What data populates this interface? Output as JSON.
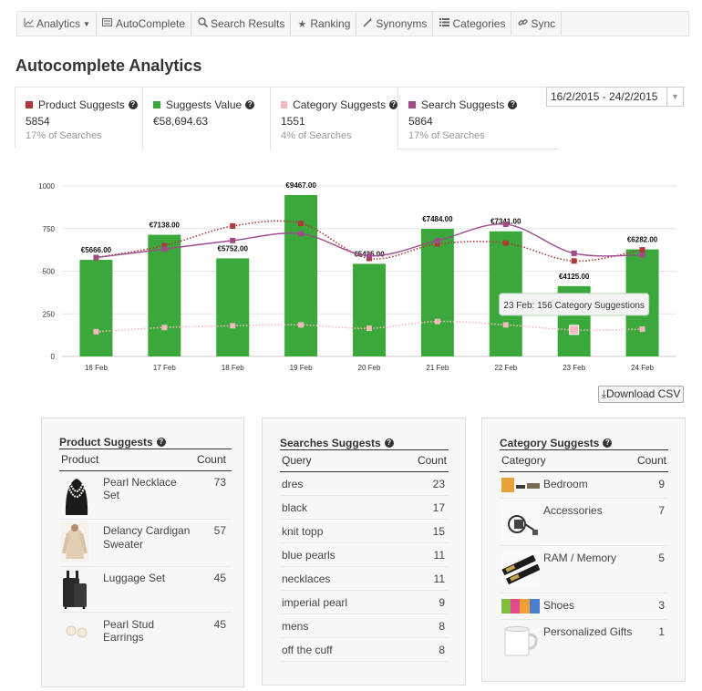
{
  "nav": {
    "items": [
      {
        "label": "Analytics",
        "icon": "line-chart-icon"
      },
      {
        "label": "AutoComplete",
        "icon": "autocomplete-icon"
      },
      {
        "label": "Search Results",
        "icon": "search-icon"
      },
      {
        "label": "Ranking",
        "icon": "star-icon"
      },
      {
        "label": "Synonyms",
        "icon": "magic-wand-icon"
      },
      {
        "label": "Categories",
        "icon": "list-icon"
      },
      {
        "label": "Sync",
        "icon": "link-icon"
      }
    ]
  },
  "page": {
    "title": "Autocomplete Analytics"
  },
  "stats": [
    {
      "label": "Product Suggests",
      "value": "5854",
      "sub": "17% of Searches",
      "color": "#b03a3a"
    },
    {
      "label": "Suggests Value",
      "value": "€58,694.63",
      "sub": "",
      "color": "#3aa83a"
    },
    {
      "label": "Category Suggests",
      "value": "1551",
      "sub": "4% of Searches",
      "color": "#f5b8c0"
    },
    {
      "label": "Search Suggests",
      "value": "5864",
      "sub": "17% of Searches",
      "color": "#a04a8c"
    }
  ],
  "daterange": {
    "value": "16/2/2015 - 24/2/2015"
  },
  "chart_data": {
    "type": "bar",
    "categories": [
      "16 Feb",
      "17 Feb",
      "18 Feb",
      "19 Feb",
      "20 Feb",
      "21 Feb",
      "22 Feb",
      "23 Feb",
      "24 Feb"
    ],
    "ylim": [
      0,
      1000
    ],
    "yticks": [
      "0",
      "250",
      "500",
      "750",
      "1000"
    ],
    "bar_series": {
      "name": "Suggests Value",
      "color": "#3aa83a",
      "values": [
        566.6,
        713.8,
        575.2,
        946.7,
        543.5,
        748.4,
        734.1,
        412.5,
        628.2
      ]
    },
    "bar_labels": [
      "€5666.00",
      "€7138.00",
      "€5752.00",
      "€9467.00",
      "€5435.00",
      "€7484.00",
      "€7341.00",
      "€4125.00",
      "€6282.00"
    ],
    "series": [
      {
        "name": "Product Suggests",
        "color": "#b03a3a",
        "style": "dotted",
        "values": [
          580,
          650,
          765,
          780,
          575,
          660,
          665,
          560,
          625
        ]
      },
      {
        "name": "Search Suggests",
        "color": "#a04a8c",
        "style": "solid",
        "values": [
          580,
          630,
          680,
          720,
          590,
          680,
          775,
          605,
          595
        ]
      },
      {
        "name": "Category Suggests",
        "color": "#f5b8c0",
        "style": "dotted",
        "values": [
          145,
          170,
          180,
          185,
          165,
          205,
          185,
          156,
          160
        ]
      }
    ],
    "tooltip": "23 Feb: 156 Category Suggestions"
  },
  "download": {
    "label": "Download CSV"
  },
  "product_panel": {
    "title": "Product Suggests",
    "col1": "Product",
    "col2": "Count",
    "rows": [
      {
        "name": "Pearl Necklace Set",
        "count": "73",
        "thumb": "necklace"
      },
      {
        "name": "Delancy Cardigan Sweater",
        "count": "57",
        "thumb": "cardigan"
      },
      {
        "name": "Luggage Set",
        "count": "45",
        "thumb": "luggage"
      },
      {
        "name": "Pearl Stud Earrings",
        "count": "45",
        "thumb": "earrings"
      }
    ]
  },
  "search_panel": {
    "title": "Searches Suggests",
    "col1": "Query",
    "col2": "Count",
    "rows": [
      {
        "name": "dres",
        "count": "23"
      },
      {
        "name": "black",
        "count": "17"
      },
      {
        "name": "knit topp",
        "count": "15"
      },
      {
        "name": "blue pearls",
        "count": "11"
      },
      {
        "name": "necklaces",
        "count": "11"
      },
      {
        "name": "imperial pearl",
        "count": "9"
      },
      {
        "name": "mens",
        "count": "8"
      },
      {
        "name": "off the cuff",
        "count": "8"
      }
    ]
  },
  "category_panel": {
    "title": "Category Suggests",
    "col1": "Category",
    "col2": "Count",
    "rows": [
      {
        "name": "Bedroom",
        "count": "9",
        "thumb": "bedroom"
      },
      {
        "name": "Accessories",
        "count": "7",
        "thumb": "accessories"
      },
      {
        "name": "RAM / Memory",
        "count": "5",
        "thumb": "ram"
      },
      {
        "name": "Shoes",
        "count": "3",
        "thumb": "shoes"
      },
      {
        "name": "Personalized Gifts",
        "count": "1",
        "thumb": "mug"
      }
    ]
  }
}
